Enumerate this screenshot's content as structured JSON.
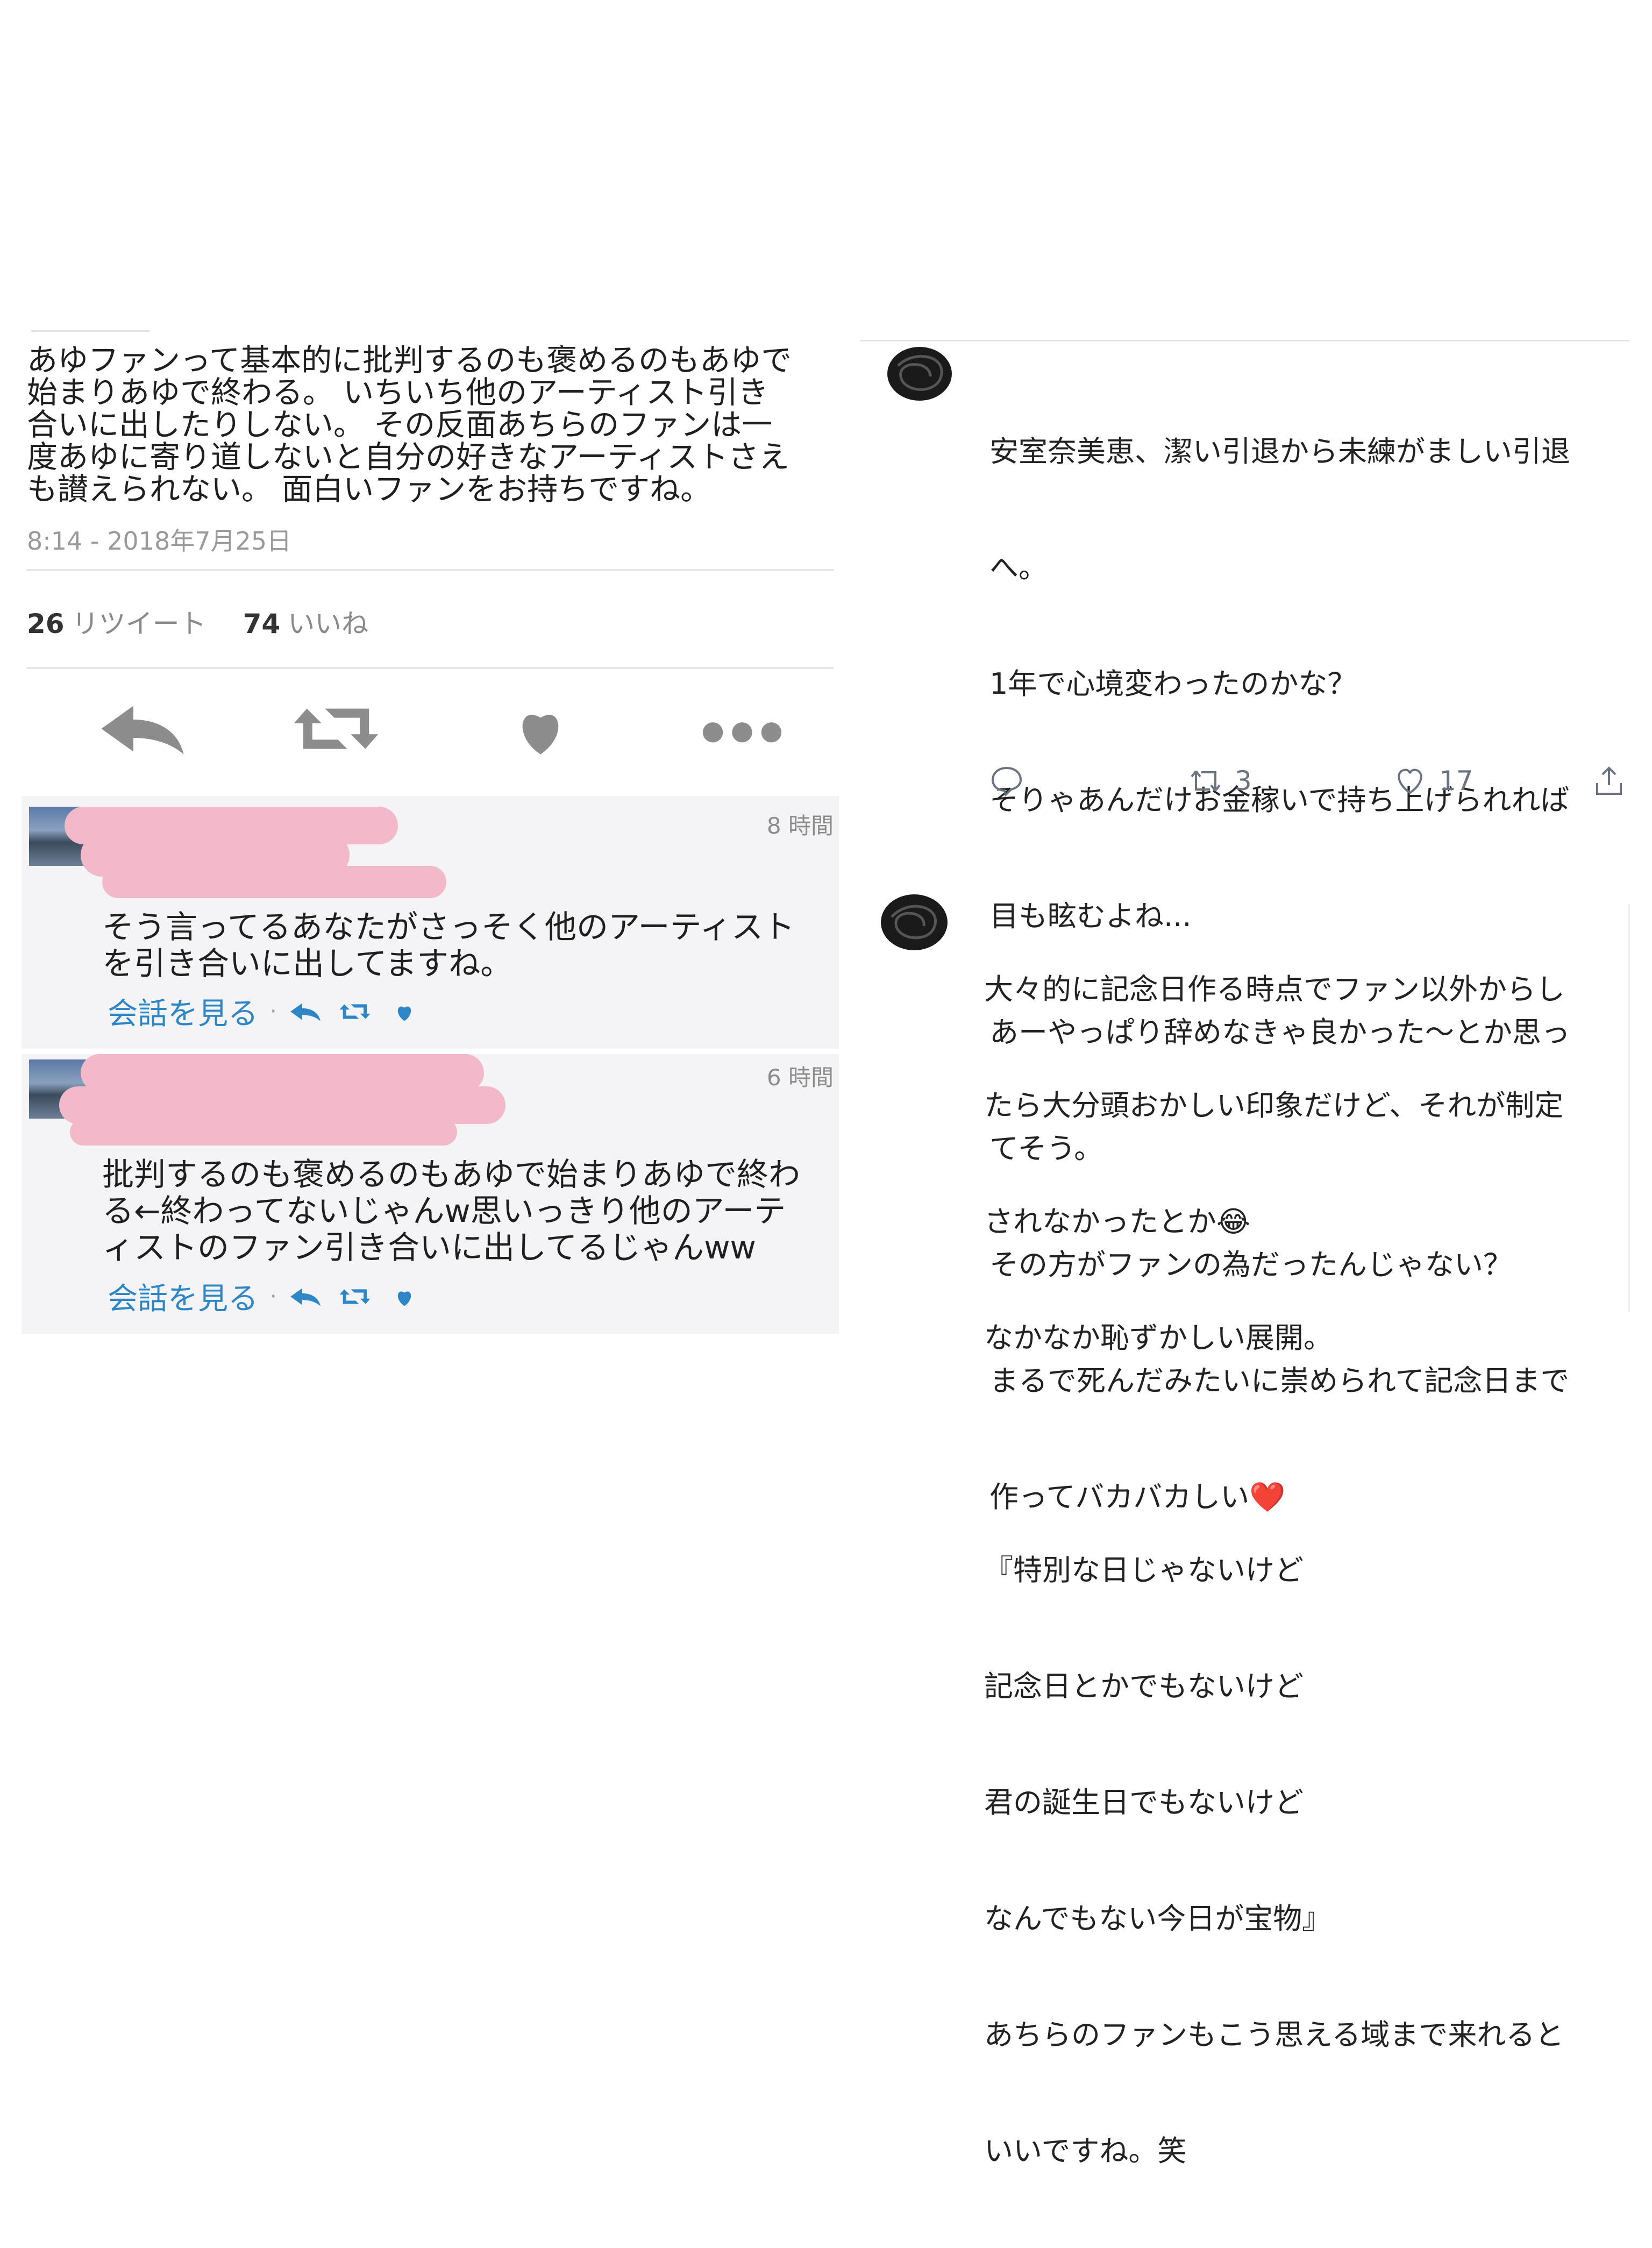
{
  "left": {
    "tweet": {
      "lines": [
        "あゆファンって基本的に批判するのも褒めるのもあゆで",
        "始まりあゆで終わる。 いちいち他のアーティスト引き",
        "合いに出したりしない。 その反面あちらのファンは一",
        "度あゆに寄り道しないと自分の好きなアーティストさえ",
        "も讃えられない。 面白いファンをお持ちですね。"
      ],
      "timestamp": "8:14 - 2018年7月25日",
      "retweet_count": "26",
      "retweet_label": "リツイート",
      "like_count": "74",
      "like_label": "いいね"
    },
    "actions": [
      "reply-icon",
      "retweet-icon",
      "heart-icon",
      "more-icon"
    ],
    "replies": [
      {
        "time": "8 時間",
        "lines": [
          "そう言ってるあなたがさっそく他のアーティスト",
          "を引き合いに出してますね。"
        ],
        "view_conversation": "会話を見る",
        "separator": "·"
      },
      {
        "time": "6 時間",
        "lines": [
          "批判するのも褒めるのもあゆで始まりあゆで終わ",
          "る←終わってないじゃんw思いっきり他のアーテ",
          "ィストのファン引き合いに出してるじゃんww"
        ],
        "view_conversation": "会話を見る",
        "separator": "·"
      }
    ],
    "colors": {
      "link": "#2e86c7",
      "redaction": "#f2b9c8",
      "reply_bg": "#f4f4f6"
    }
  },
  "right": {
    "post1": {
      "lines": [
        "安室奈美恵、潔い引退から未練がましい引退",
        "へ。",
        "1年で心境変わったのかな？",
        "そりゃあんだけお金稼いで持ち上げられれば",
        "目も眩むよね...",
        "あーやっぱり辞めなきゃ良かった〜とか思っ",
        "てそう。",
        "その方がファンの為だったんじゃない？",
        "まるで死んだみたいに崇められて記念日まで",
        "作ってバカバカしい"
      ],
      "emoji": "❤️",
      "reply_icon": "speech-bubble-icon",
      "retweet_count": "3",
      "like_count": "17",
      "share_icon": "share-icon"
    },
    "post2": {
      "lines": [
        "大々的に記念日作る時点でファン以外からし",
        "たら大分頭おかしい印象だけど、それが制定",
        "されなかったとか",
        "なかなか恥ずかしい展開。",
        "",
        "『特別な日じゃないけど",
        "記念日とかでもないけど",
        "君の誕生日でもないけど",
        "なんでもない今日が宝物』",
        "あちらのファンもこう思える域まで来れると",
        "いいですね。笑"
      ],
      "emoji": "😂"
    }
  }
}
